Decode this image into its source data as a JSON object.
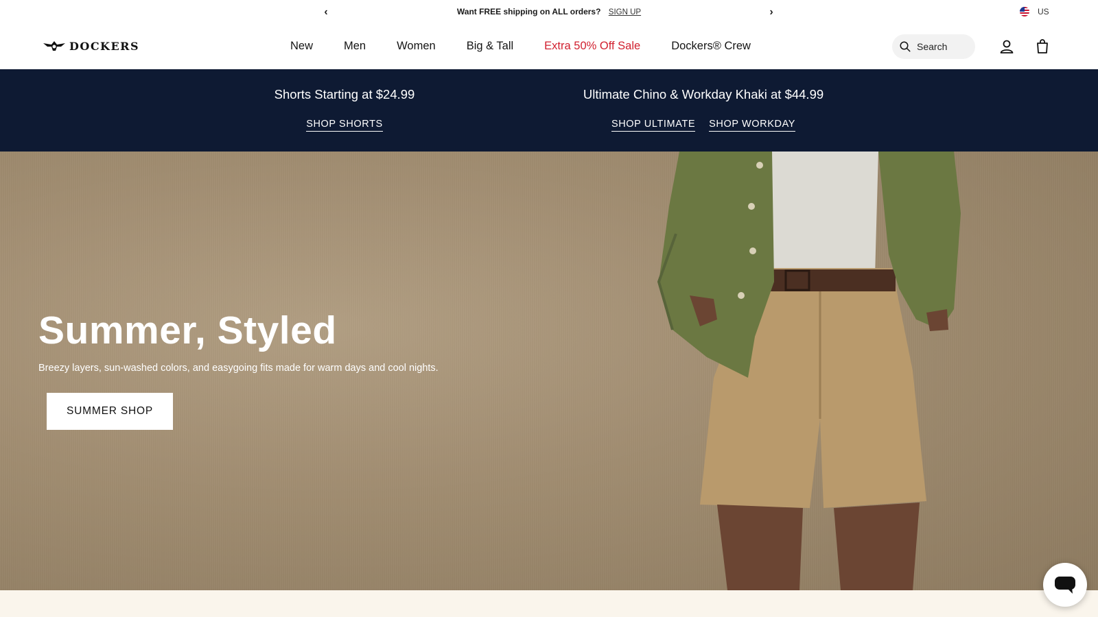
{
  "announcement": {
    "message": "Want FREE shipping on ALL orders?",
    "link": "SIGN UP",
    "prev_icon": "chevron-left-icon",
    "next_icon": "chevron-right-icon"
  },
  "locale": {
    "label": "US",
    "icon": "us-flag-icon"
  },
  "header": {
    "logo_text": "DOCKERS",
    "nav": [
      "New",
      "Men",
      "Women",
      "Big & Tall",
      "Extra 50% Off Sale",
      "Dockers® Crew"
    ],
    "sale_color": "#d1202f",
    "search_placeholder": "Search",
    "icons": [
      "search-icon",
      "account-icon",
      "cart-icon"
    ]
  },
  "promo": {
    "background": "#0e1a33",
    "left": {
      "heading": "Shorts Starting at $24.99",
      "links": [
        "SHOP SHORTS"
      ]
    },
    "right": {
      "heading": "Ultimate Chino & Workday Khaki at $44.99",
      "links": [
        "SHOP ULTIMATE",
        "SHOP WORKDAY"
      ]
    }
  },
  "hero": {
    "title": "Summer, Styled",
    "subtitle": "Breezy layers, sun-washed colors, and easygoing fits made for warm days and cool nights.",
    "cta": "SUMMER SHOP"
  },
  "chat": {
    "icon": "chat-bubble-icon"
  }
}
